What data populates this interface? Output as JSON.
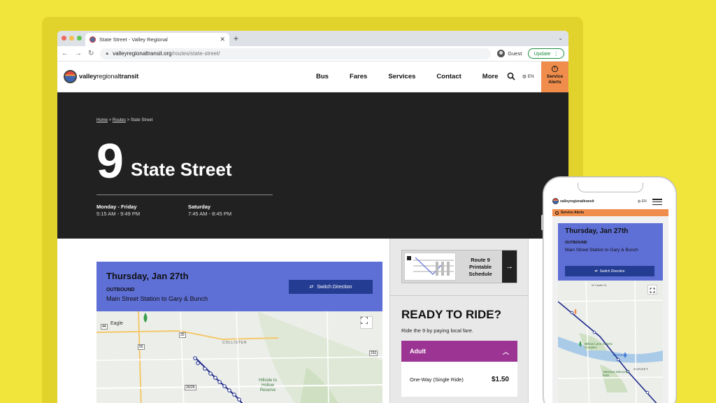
{
  "browser": {
    "tab_title": "State Street - Valley Regional",
    "tab_close": "✕",
    "new_tab": "+",
    "url_host": "valleyregionaltransit.org",
    "url_path": "/routes/state-street/",
    "profile_label": "Guest",
    "update_label": "Update"
  },
  "site": {
    "logo_brand": "valley",
    "logo_regional": "regional",
    "logo_transit": "transit",
    "nav": [
      "Bus",
      "Fares",
      "Services",
      "Contact",
      "More"
    ],
    "lang": "EN",
    "alerts_label": "Service Alerts"
  },
  "hero": {
    "breadcrumb_home": "Home",
    "breadcrumb_sep1": " > ",
    "breadcrumb_routes": "Routes",
    "breadcrumb_sep2": " > ",
    "breadcrumb_current": "State Street",
    "route_number": "9",
    "route_name": "State Street",
    "service": [
      {
        "days": "Monday - Friday",
        "hours": "5:15 AM - 9:49 PM"
      },
      {
        "days": "Saturday",
        "hours": "7:45 AM - 8:45 PM"
      }
    ]
  },
  "trip": {
    "date": "Thursday, Jan 27th",
    "direction": "OUTBOUND",
    "description": "Main Street Station to Gary & Bunch",
    "switch_label": "Switch Direction"
  },
  "map": {
    "labels": [
      "Eagle",
      "COLLISTER",
      "Hillside to Hollow Reserve",
      "44",
      "55",
      "20",
      "20/26",
      "231"
    ]
  },
  "sidebar": {
    "schedule_title": "Route 9 Printable Schedule",
    "ready_heading": "READY TO RIDE?",
    "ready_sub": "Ride the 9 by paying local fare.",
    "fare_group": "Adult",
    "fare_item": "One-Way (Single Ride)",
    "fare_price": "$1.50"
  },
  "mobile": {
    "logo_text": "valleyregionaltransit",
    "lang": "EN",
    "alerts_label": "Service Alerts",
    "date": "Thursday, Jan 27th",
    "direction": "OUTBOUND",
    "description": "Main Street Station to Gary & Bunch",
    "switch_label": "Switch Direction",
    "map_labels": [
      "W Castle Dr",
      "Willow Lane Athletic Complex",
      "SUNSET",
      "Veterans Memorial Park",
      "Albertsons"
    ]
  },
  "colors": {
    "background": "#f1e43a",
    "hero": "#212121",
    "card": "#5e6fd6",
    "button": "#243d93",
    "alert": "#f08d4c",
    "fare_header": "#9c3494",
    "route_line": "#1d2a8a"
  }
}
